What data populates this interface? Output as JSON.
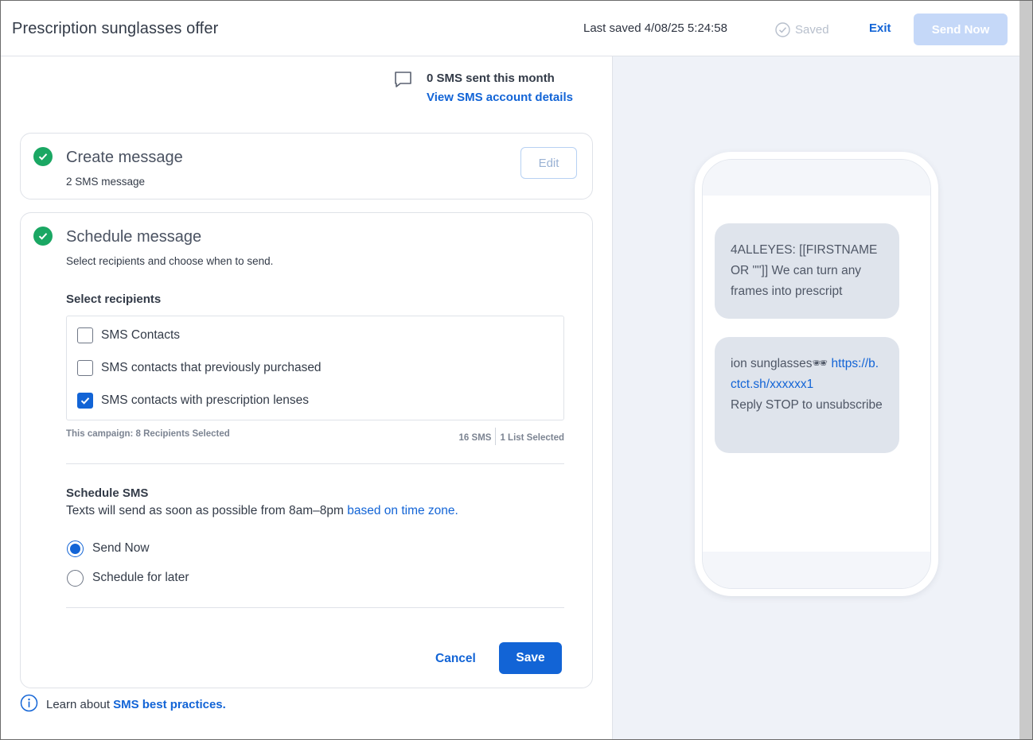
{
  "header": {
    "title": "Prescription sunglasses offer",
    "last_saved": "Last saved 4/08/25 5:24:58",
    "saved_label": "Saved",
    "exit_label": "Exit",
    "send_now_label": "Send Now"
  },
  "sms_account": {
    "count_text": "0 SMS sent this month",
    "link_text": "View SMS account details"
  },
  "create_card": {
    "title": "Create message",
    "subtitle": "2 SMS message",
    "edit_label": "Edit"
  },
  "schedule_card": {
    "title": "Schedule message",
    "subtitle": "Select recipients and choose when to send.",
    "recipients_label": "Select recipients",
    "recipients": [
      {
        "label": "SMS Contacts",
        "checked": false
      },
      {
        "label": "SMS contacts that previously purchased",
        "checked": false
      },
      {
        "label": "SMS contacts with prescription lenses",
        "checked": true
      }
    ],
    "campaign_summary": "This campaign: 8 Recipients Selected",
    "sms_count": "16 SMS",
    "lists_selected": "1 List Selected",
    "schedule_label": "Schedule SMS",
    "schedule_desc": "Texts will send as soon as possible from 8am–8pm",
    "schedule_link": "based on time zone.",
    "options": [
      {
        "label": "Send Now",
        "selected": true
      },
      {
        "label": "Schedule for later",
        "selected": false
      }
    ],
    "cancel_label": "Cancel",
    "save_label": "Save"
  },
  "footer": {
    "learn_prefix": "Learn about",
    "learn_link": "SMS best practices."
  },
  "preview": {
    "bubble1": "4ALLEYES: [[FIRSTNAME OR \"\"]] We can turn any frames into prescript",
    "bubble2_text": "ion sunglasses",
    "bubble2_emoji": "🕶",
    "bubble2_link": "https://b.ctct.sh/xxxxxx1",
    "bubble2_tail": "Reply STOP to unsubscribe"
  },
  "colors": {
    "accent": "#1264d6",
    "success": "#1aa763",
    "preview_bg": "#eff2f8",
    "bubble_bg": "#dfe4ec"
  }
}
